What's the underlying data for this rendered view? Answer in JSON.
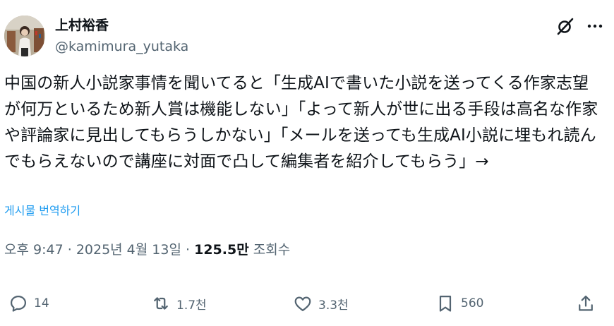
{
  "author": {
    "display_name": "上村裕香",
    "handle": "@kamimura_yutaka",
    "avatar_icon": "avatar-photo"
  },
  "header": {
    "grok_icon": "grok-icon",
    "more_icon": "more-dots-icon"
  },
  "tweet": {
    "text": "中国の新人小説家事情を聞いてると「生成AIで書いた小説を送ってくる作家志望が何万といるため新人賞は機能しない」「よって新人が世に出る手段は高名な作家や評論家に見出してもらうしかない」「メールを送っても生成AI小説に埋もれ読んでもらえないので講座に対面で凸して編集者を紹介してもらう」→",
    "translate_label": "게시물 번역하기"
  },
  "meta": {
    "time": "오후 9:47",
    "separator": "·",
    "date": "2025년 4월 13일",
    "views_count": "125.5만",
    "views_label": "조회수"
  },
  "actions": {
    "reply_count": "14",
    "retweet_count": "1.7천",
    "like_count": "3.3천",
    "bookmark_count": "560"
  },
  "colors": {
    "text": "#0f1419",
    "secondary": "#536471",
    "link": "#1d9bf0"
  }
}
